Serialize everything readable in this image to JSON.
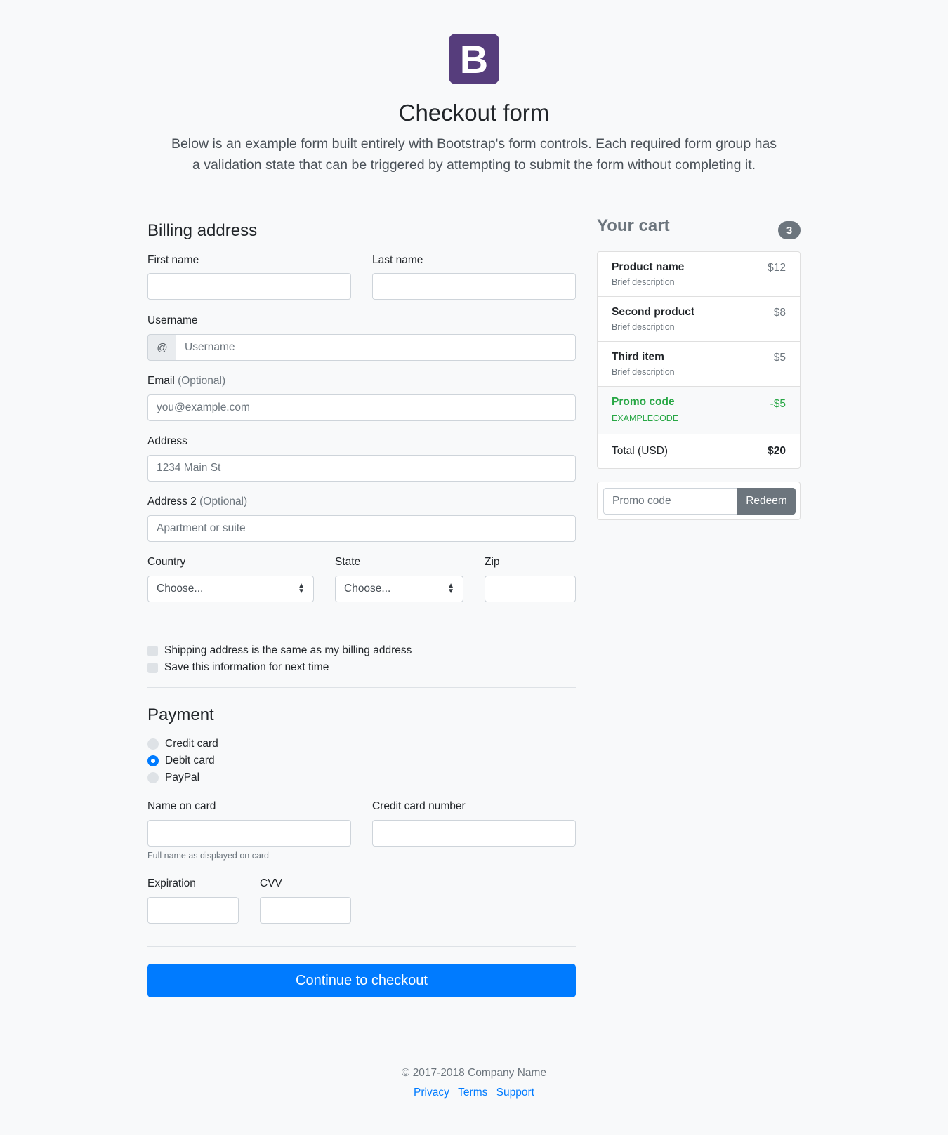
{
  "header": {
    "logo_letter": "B",
    "title": "Checkout form",
    "lead": "Below is an example form built entirely with Bootstrap's form controls. Each required form group has a validation state that can be triggered by attempting to submit the form without completing it."
  },
  "billing": {
    "title": "Billing address",
    "first_name_label": "First name",
    "last_name_label": "Last name",
    "username_label": "Username",
    "username_prefix": "@",
    "username_placeholder": "Username",
    "email_label": "Email",
    "email_optional": "(Optional)",
    "email_placeholder": "you@example.com",
    "address_label": "Address",
    "address_placeholder": "1234 Main St",
    "address2_label": "Address 2",
    "address2_optional": "(Optional)",
    "address2_placeholder": "Apartment or suite",
    "country_label": "Country",
    "country_value": "Choose...",
    "state_label": "State",
    "state_value": "Choose...",
    "zip_label": "Zip",
    "same_address_label": "Shipping address is the same as my billing address",
    "save_info_label": "Save this information for next time"
  },
  "payment": {
    "title": "Payment",
    "options": [
      {
        "label": "Credit card",
        "checked": false
      },
      {
        "label": "Debit card",
        "checked": true
      },
      {
        "label": "PayPal",
        "checked": false
      }
    ],
    "name_on_card_label": "Name on card",
    "name_on_card_help": "Full name as displayed on card",
    "card_number_label": "Credit card number",
    "expiration_label": "Expiration",
    "cvv_label": "CVV",
    "submit_label": "Continue to checkout"
  },
  "cart": {
    "title": "Your cart",
    "count": "3",
    "items": [
      {
        "name": "Product name",
        "desc": "Brief description",
        "price": "$12"
      },
      {
        "name": "Second product",
        "desc": "Brief description",
        "price": "$8"
      },
      {
        "name": "Third item",
        "desc": "Brief description",
        "price": "$5"
      }
    ],
    "promo": {
      "name": "Promo code",
      "code": "EXAMPLECODE",
      "amount": "-$5"
    },
    "total": {
      "label": "Total (USD)",
      "value": "$20"
    },
    "promo_placeholder": "Promo code",
    "redeem_label": "Redeem"
  },
  "footer": {
    "copyright": "© 2017-2018 Company Name",
    "links": [
      "Privacy",
      "Terms",
      "Support"
    ]
  },
  "colors": {
    "brand": "#563d7c",
    "primary": "#007bff",
    "success": "#28a745",
    "muted": "#6c757d"
  }
}
